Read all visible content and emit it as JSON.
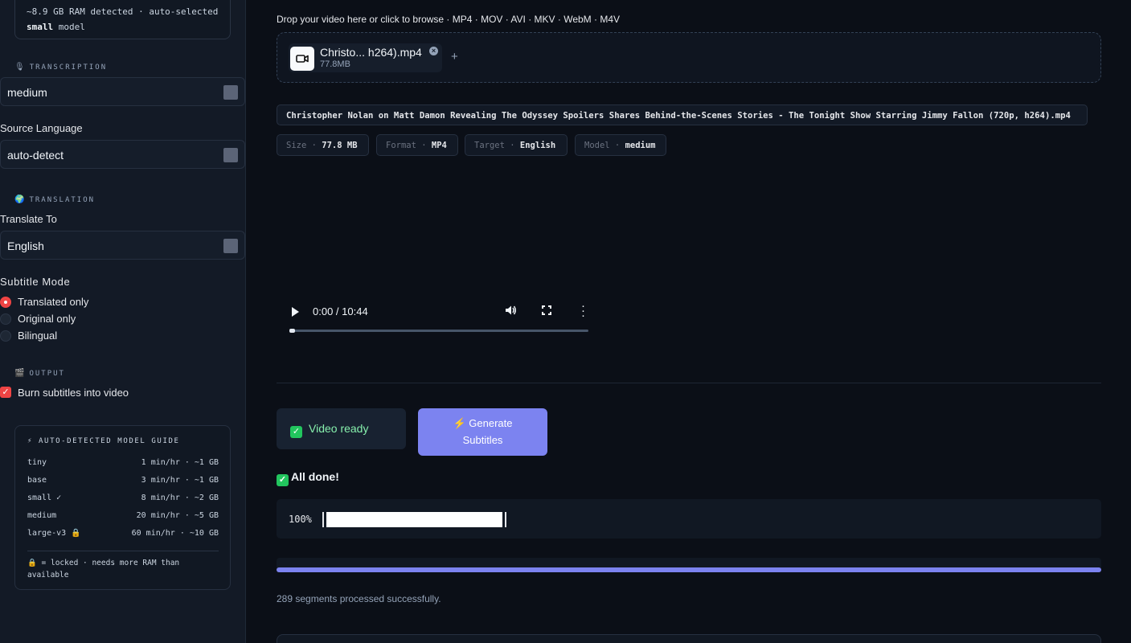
{
  "sidebar": {
    "ram_line1": "~8.9 GB RAM detected · auto-selected",
    "ram_bold": "small",
    "ram_line2_rest": " model",
    "transcription": {
      "icon": "microphone-icon",
      "heading": "TRANSCRIPTION",
      "model_value": "medium",
      "source_label": "Source Language",
      "source_value": "auto-detect"
    },
    "translation": {
      "icon": "globe-icon",
      "heading": "TRANSLATION",
      "target_label": "Translate To",
      "target_value": "English"
    },
    "subtitle_mode": {
      "label": "Subtitle Mode",
      "options": [
        "Translated only",
        "Original only",
        "Bilingual"
      ],
      "selected": "Translated only"
    },
    "output": {
      "icon": "clapper-icon",
      "heading": "OUTPUT",
      "burn_label": "Burn subtitles into video",
      "burn_checked": true
    },
    "guide": {
      "title": "⚡ AUTO-DETECTED MODEL GUIDE",
      "rows": [
        {
          "name": "tiny",
          "spec": "1 min/hr · ~1 GB"
        },
        {
          "name": "base",
          "spec": "3 min/hr · ~1 GB"
        },
        {
          "name": "small ✓",
          "spec": "8 min/hr · ~2 GB"
        },
        {
          "name": "medium",
          "spec": "20 min/hr · ~5 GB"
        },
        {
          "name": "large-v3 🔒",
          "spec": "60 min/hr · ~10 GB"
        }
      ],
      "note": "🔒 = locked · needs more RAM than available"
    }
  },
  "upload": {
    "label": "Drop your video here or click to browse · MP4 · MOV · AVI · MKV · WebM · M4V",
    "file_name": "Christo... h264).mp4",
    "file_size": "77.8MB",
    "plus": "+"
  },
  "file_info": {
    "title": "Christopher Nolan on Matt Damon Revealing The Odyssey Spoilers Shares Behind-the-Scenes Stories - The Tonight Show Starring Jimmy Fallon (720p, h264).mp4",
    "tags": [
      {
        "key": "Size",
        "value": "77.8 MB"
      },
      {
        "key": "Format",
        "value": "MP4"
      },
      {
        "key": "Target",
        "value": "English"
      },
      {
        "key": "Model",
        "value": "medium"
      }
    ]
  },
  "player": {
    "time": "0:00 / 10:44",
    "played_fraction": 0.0
  },
  "status": {
    "ready_text": "Video ready",
    "generate_label_line1": "⚡ Generate",
    "generate_label_line2": "Subtitles",
    "done_text": "All done!",
    "progress_pct_text": "100%",
    "progress_fraction": 1.0,
    "segments_text": "289 segments processed successfully."
  },
  "colors": {
    "accent": "#7c83f0",
    "danger": "#ef4444",
    "success": "#22c55e"
  }
}
